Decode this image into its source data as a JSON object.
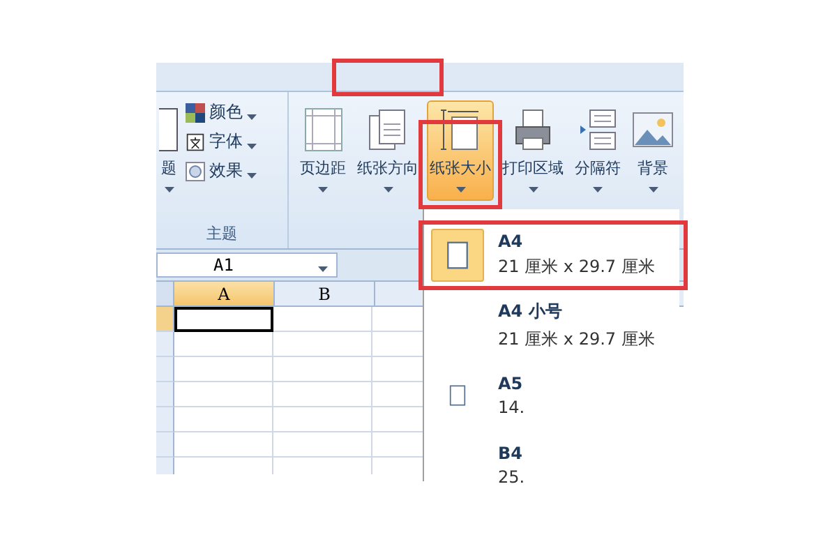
{
  "ribbon": {
    "groups": [
      {
        "label": "主题",
        "big_buttons": [
          {
            "label": "题",
            "selected": false
          }
        ],
        "small_buttons": [
          {
            "label": "颜色"
          },
          {
            "label": "字体"
          },
          {
            "label": "效果"
          }
        ]
      },
      {
        "big_buttons": [
          {
            "label": "页边距",
            "selected": false
          },
          {
            "label": "纸张方向",
            "selected": false
          },
          {
            "label": "纸张大小",
            "selected": true
          },
          {
            "label": "打印区域",
            "selected": false
          },
          {
            "label": "分隔符",
            "selected": false
          },
          {
            "label": "背景",
            "selected": false
          }
        ]
      }
    ]
  },
  "name_box": {
    "value": "A1"
  },
  "sheet": {
    "columns": [
      {
        "label": "A",
        "selected": true
      },
      {
        "label": "B",
        "selected": false
      }
    ]
  },
  "paper_menu": {
    "items": [
      {
        "name": "A4",
        "size": "21 厘米 x 29.7 厘米",
        "selected": true,
        "kind": "icon"
      },
      {
        "name": "A4 小号",
        "size": "21 厘米 x 29.7 厘米",
        "selected": false,
        "kind": "plain"
      },
      {
        "name": "A5",
        "size": "14.",
        "selected": false,
        "kind": "icon"
      },
      {
        "name": "B4",
        "size": "25.",
        "selected": false,
        "kind": "plain"
      }
    ]
  }
}
